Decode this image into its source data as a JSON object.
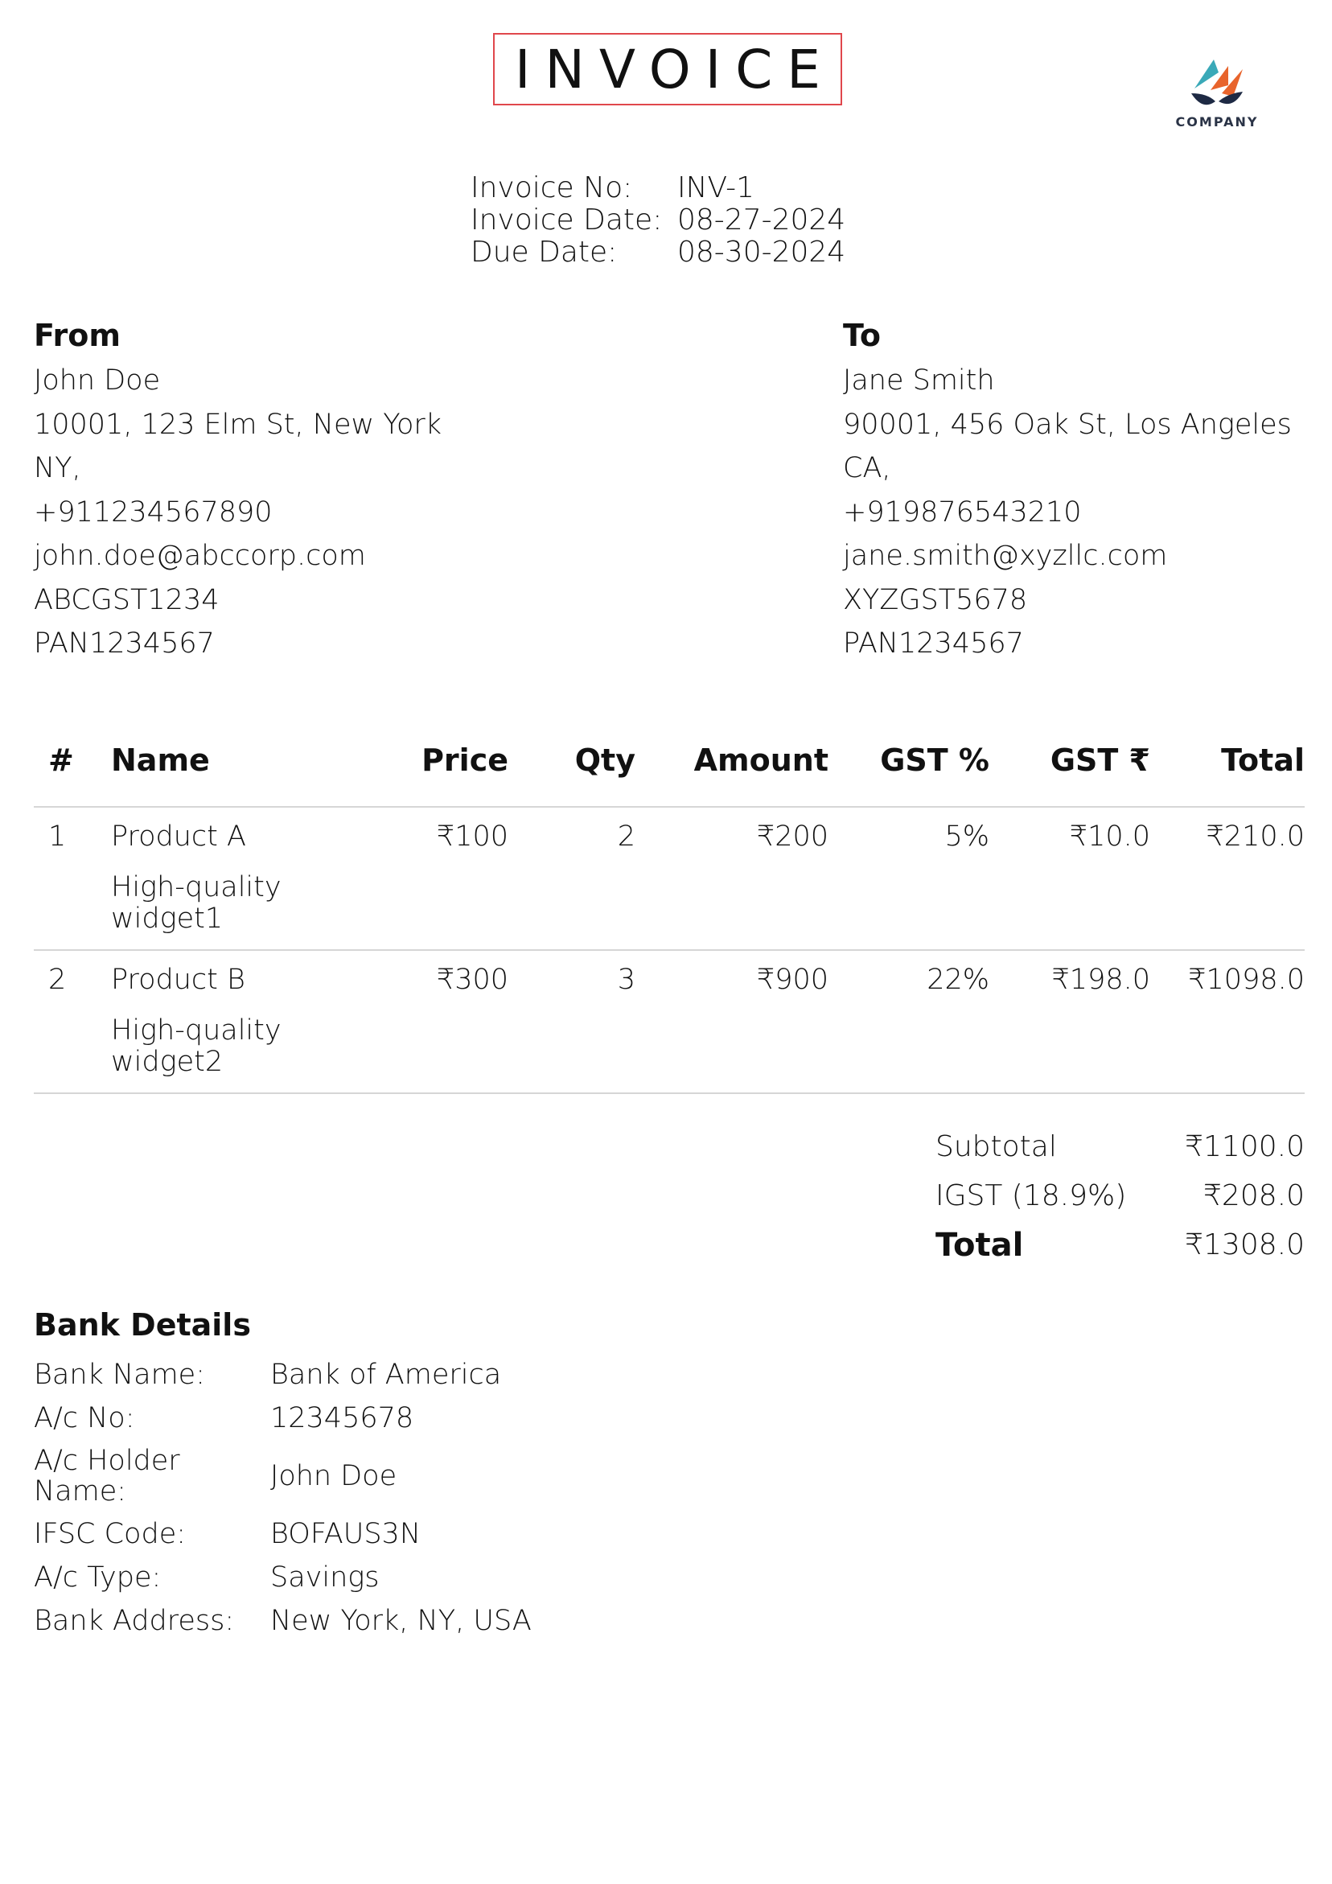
{
  "title": "INVOICE",
  "logo": {
    "text": "COMPANY",
    "icon": "company-leaf-logo-icon",
    "colors": [
      "#3aa9b8",
      "#e8642c",
      "#1e2a44"
    ]
  },
  "accent_color": "#e0474c",
  "meta": {
    "invoice_no_label": "Invoice No:",
    "invoice_no": "INV-1",
    "invoice_date_label": "Invoice Date:",
    "invoice_date": "08-27-2024",
    "due_date_label": "Due Date:",
    "due_date": "08-30-2024"
  },
  "from": {
    "heading": "From",
    "lines": [
      "John Doe",
      "10001, 123 Elm St, New York",
      "NY,",
      "+911234567890",
      "john.doe@abccorp.com",
      "ABCGST1234",
      "PAN1234567"
    ]
  },
  "to": {
    "heading": "To",
    "lines": [
      "Jane Smith",
      "90001, 456 Oak St, Los Angeles",
      "CA,",
      "+919876543210",
      "jane.smith@xyzllc.com",
      "XYZGST5678",
      "PAN1234567"
    ]
  },
  "table": {
    "headers": [
      "#",
      "Name",
      "Price",
      "Qty",
      "Amount",
      "GST %",
      "GST ₹",
      "Total"
    ],
    "rows": [
      {
        "num": "1",
        "name": "Product A",
        "desc": "High-quality widget1",
        "price": "₹100",
        "qty": "2",
        "amount": "₹200",
        "gst_pct": "5%",
        "gst": "₹10.0",
        "total": "₹210.0"
      },
      {
        "num": "2",
        "name": "Product B",
        "desc": "High-quality widget2",
        "price": "₹300",
        "qty": "3",
        "amount": "₹900",
        "gst_pct": "22%",
        "gst": "₹198.0",
        "total": "₹1098.0"
      }
    ]
  },
  "totals": {
    "subtotal_label": "Subtotal",
    "subtotal": "₹1100.0",
    "igst_label": "IGST (18.9%)",
    "igst": "₹208.0",
    "total_label": "Total",
    "total": "₹1308.0"
  },
  "bank": {
    "heading": "Bank Details",
    "rows": [
      {
        "label": "Bank Name:",
        "value": "Bank of America"
      },
      {
        "label": "A/c No:",
        "value": "12345678"
      },
      {
        "label": "A/c Holder Name:",
        "value": "John Doe"
      },
      {
        "label": "IFSC Code:",
        "value": "BOFAUS3N"
      },
      {
        "label": "A/c Type:",
        "value": "Savings"
      },
      {
        "label": "Bank Address:",
        "value": "New York, NY, USA"
      }
    ]
  }
}
